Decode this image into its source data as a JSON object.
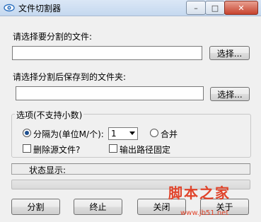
{
  "window": {
    "title": "文件切割器",
    "minimize_glyph": "–",
    "maximize_glyph": "□",
    "close_glyph": "✕"
  },
  "source": {
    "label": "请选择要分割的文件:",
    "value": "",
    "browse_label": "选择..."
  },
  "target": {
    "label": "请选择分割后保存到的文件夹:",
    "value": "",
    "browse_label": "选择..."
  },
  "options": {
    "group_title": "选项(不支持小数)",
    "split_label": "分隔为(单位M/个):",
    "split_selected": true,
    "split_value": "1",
    "merge_label": "合并",
    "merge_selected": false,
    "delete_source_label": "删除源文件?",
    "delete_source_checked": false,
    "fixed_output_label": "输出路径固定",
    "fixed_output_checked": false
  },
  "status": {
    "label": "状态显示:",
    "progress": 0
  },
  "actions": {
    "split_label": "分割",
    "stop_label": "终止",
    "close_label": "关闭",
    "about_label": "关于"
  },
  "watermark": {
    "brand": "脚本之家",
    "url": "www.jb51.net"
  },
  "icons": {
    "app": "eye-icon",
    "dropdown": "chevron-down-icon"
  }
}
